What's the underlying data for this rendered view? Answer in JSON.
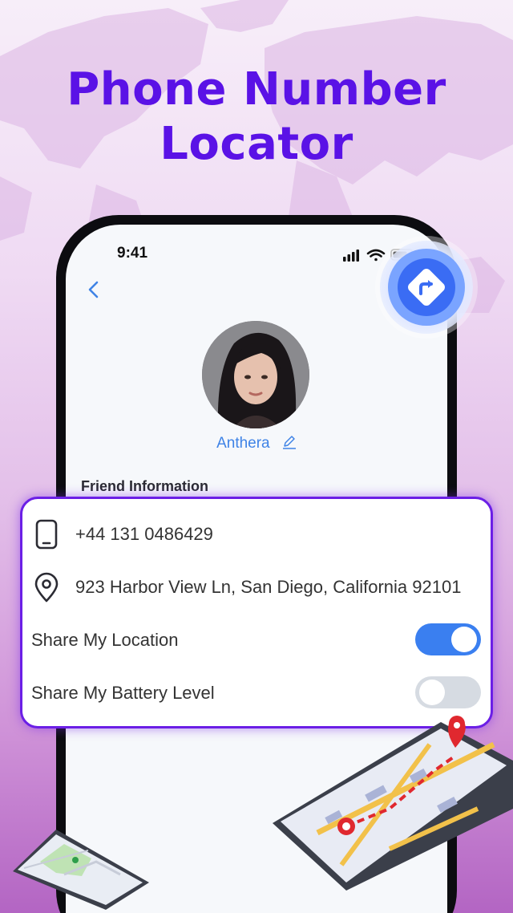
{
  "promo": {
    "headline_line1": "Phone Number",
    "headline_line2": "Locator"
  },
  "status_bar": {
    "time": "9:41",
    "icons": [
      "signal-icon",
      "wifi-icon",
      "battery-icon"
    ]
  },
  "navigation": {
    "back_icon": "chevron-left-icon"
  },
  "profile": {
    "name": "Anthera",
    "edit_icon": "pencil-icon",
    "section_label": "Friend Information"
  },
  "info_card": {
    "phone": "+44  131 0486429",
    "phone_icon": "phone-icon",
    "address": "923 Harbor View Ln, San Diego, California 92101",
    "address_icon": "location-pin-icon",
    "share_location_label": "Share My Location",
    "share_location_enabled": true,
    "share_battery_label": "Share My Battery Level",
    "share_battery_enabled": false
  },
  "floating_button": {
    "icon": "directions-icon"
  },
  "colors": {
    "headline": "#5a12e6",
    "accent_blue": "#3a7ff0",
    "card_border": "#6b1fe6",
    "toggle_off": "#d6dbe2"
  }
}
